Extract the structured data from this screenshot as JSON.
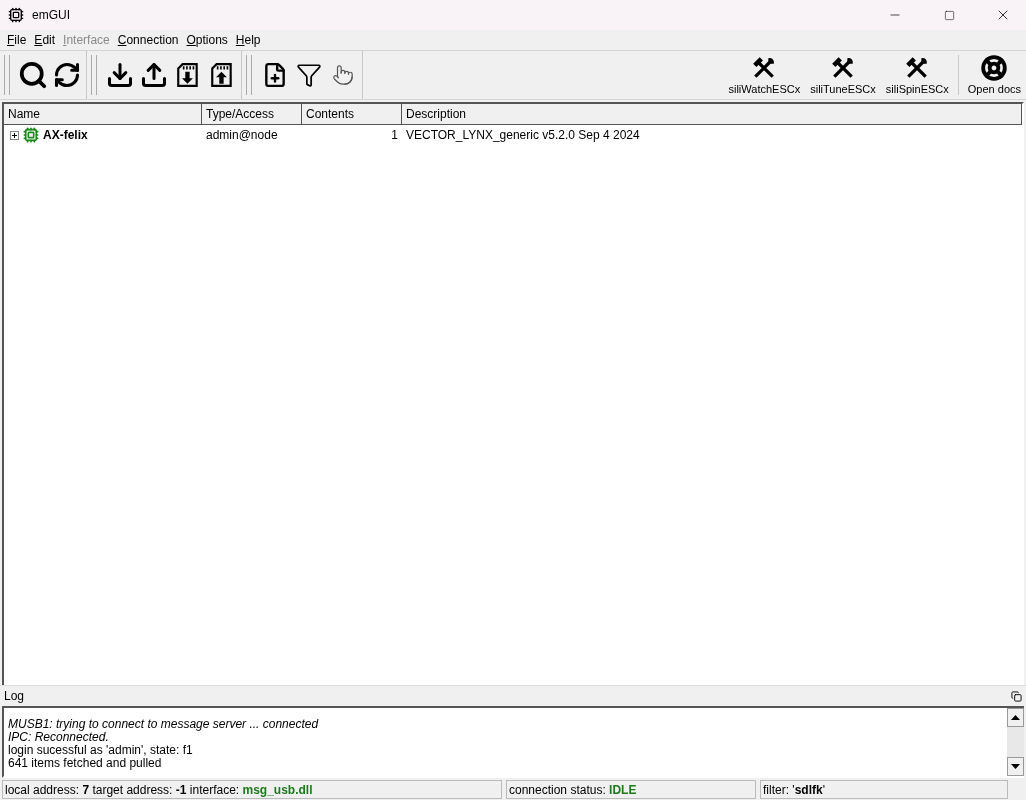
{
  "window": {
    "title": "emGUI"
  },
  "menu": [
    {
      "label": "File",
      "disabled": false
    },
    {
      "label": "Edit",
      "disabled": false
    },
    {
      "label": "Interface",
      "disabled": true
    },
    {
      "label": "Connection",
      "disabled": false
    },
    {
      "label": "Options",
      "disabled": false
    },
    {
      "label": "Help",
      "disabled": false
    }
  ],
  "toolbar_groups": [
    [
      {
        "kind": "search"
      },
      {
        "kind": "refresh"
      }
    ],
    [
      {
        "kind": "download"
      },
      {
        "kind": "upload"
      },
      {
        "kind": "card-down"
      },
      {
        "kind": "card-up"
      }
    ],
    [
      {
        "kind": "add-file"
      },
      {
        "kind": "filter"
      },
      {
        "kind": "hand"
      }
    ]
  ],
  "tools": [
    {
      "label": "siliWatchESCx",
      "kind": "tool"
    },
    {
      "label": "siliTuneESCx",
      "kind": "tool"
    },
    {
      "label": "siliSpinESCx",
      "kind": "tool"
    },
    {
      "label": "Open docs",
      "kind": "docs"
    }
  ],
  "table": {
    "columns": [
      "Name",
      "Type/Access",
      "Contents",
      "Description"
    ],
    "rows": [
      {
        "name": "AX-felix",
        "type": "admin@node",
        "contents": "1",
        "description": "VECTOR_LYNX_generic v5.2.0 Sep  4 2024",
        "expanded": false
      }
    ]
  },
  "log": {
    "title": "Log",
    "lines": [
      {
        "text": "MUSB1: trying to connect to message server ... connected",
        "italic": true
      },
      {
        "text": "IPC: Reconnected.",
        "italic": true
      },
      {
        "text": "login sucessful as 'admin', state: f1",
        "italic": false
      },
      {
        "text": "641 items fetched and pulled",
        "italic": false
      }
    ]
  },
  "status_bar": [
    {
      "parts": [
        {
          "text": "local address: ",
          "kind": "plain"
        },
        {
          "text": "7",
          "kind": "bold"
        },
        {
          "text": " target address: ",
          "kind": "plain"
        },
        {
          "text": "-1",
          "kind": "bold"
        },
        {
          "text": " interface: ",
          "kind": "plain"
        },
        {
          "text": "msg_usb.dll",
          "kind": "good"
        }
      ]
    },
    {
      "parts": [
        {
          "text": "connection status: ",
          "kind": "plain"
        },
        {
          "text": "IDLE",
          "kind": "good"
        }
      ]
    },
    {
      "parts": [
        {
          "text": "filter: '",
          "kind": "plain"
        },
        {
          "text": "sdlfk",
          "kind": "bold"
        },
        {
          "text": "'",
          "kind": "plain"
        }
      ]
    }
  ]
}
